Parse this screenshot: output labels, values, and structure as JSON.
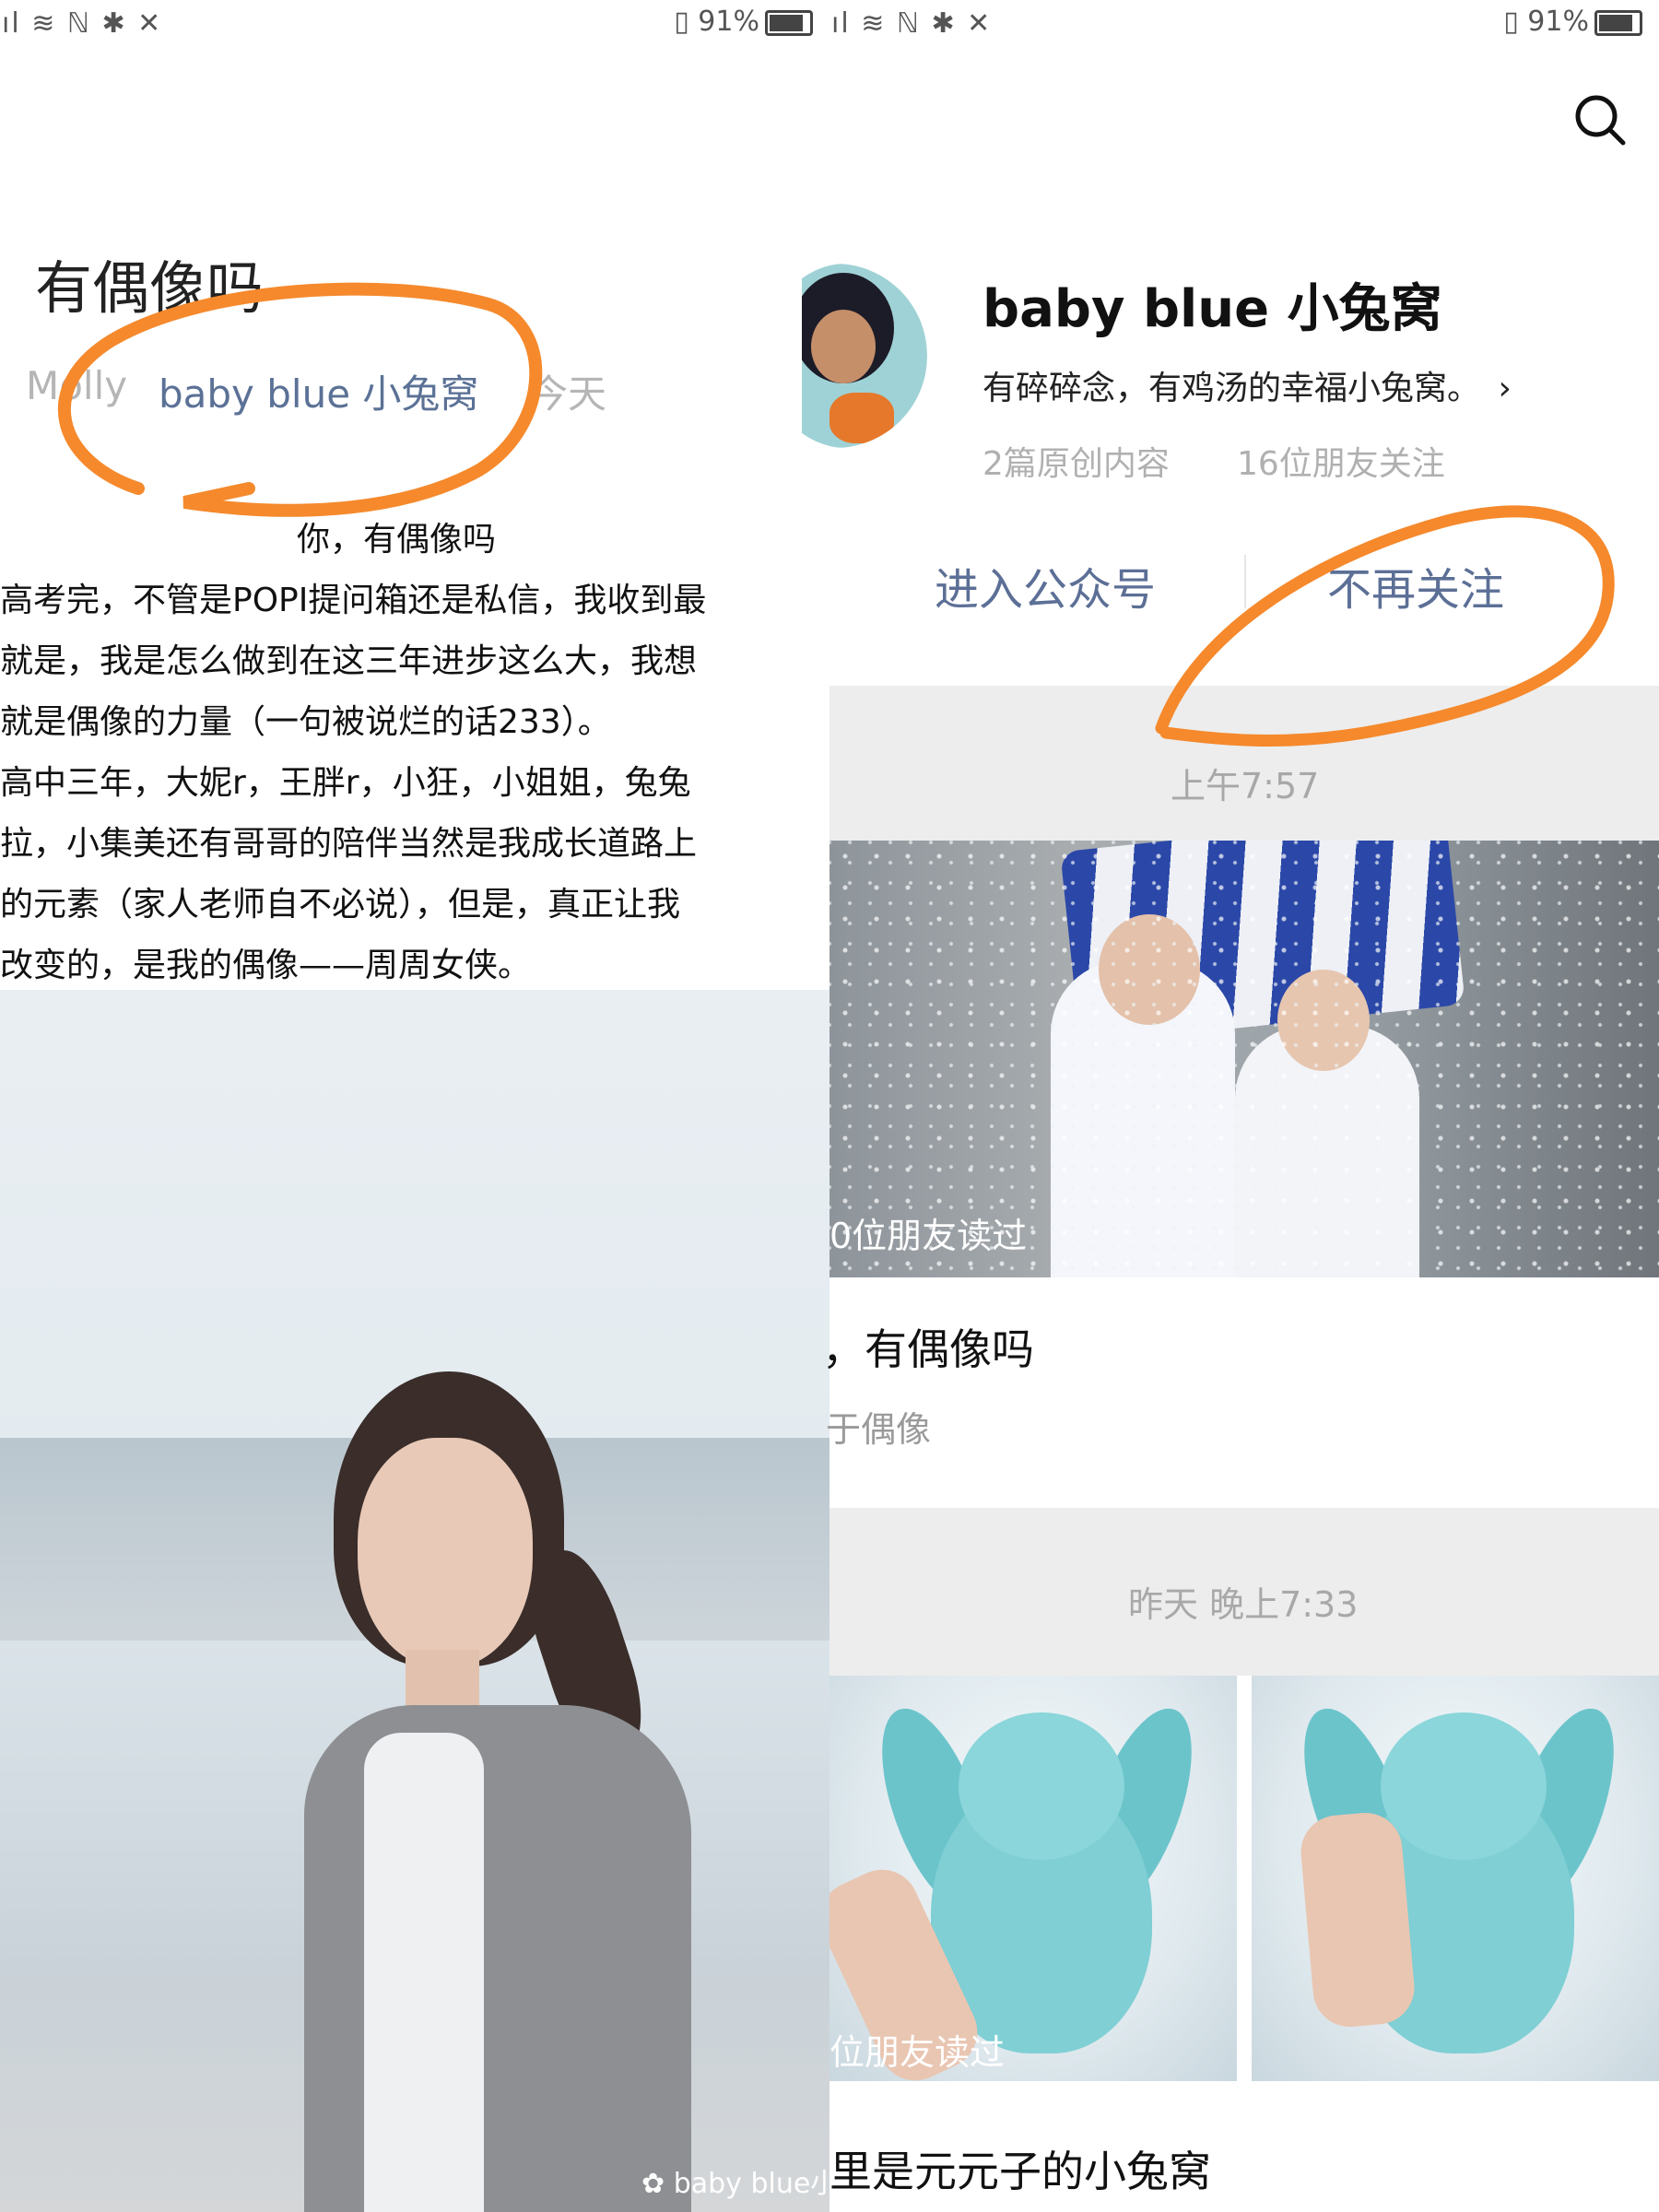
{
  "left": {
    "status_left": "ıl ≋ ℕ ✱ ✕",
    "status_right": "▯ 91%",
    "article_title": "有偶像吗",
    "author": "Molly",
    "account_link": "baby blue 小兔窝",
    "date": "今天",
    "paragraphs": [
      "你，有偶像吗",
      "高考完，不管是POPI提问箱还是私信，我收到最",
      "就是，我是怎么做到在这三年进步这么大，我想",
      "就是偶像的力量（一句被说烂的话233）。",
      "高中三年，大妮r，王胖r，小狂，小姐姐，兔兔",
      "拉，小集美还有哥哥的陪伴当然是我成长道路上",
      "的元素（家人老师自不必说），但是，真正让我",
      "改变的，是我的偶像——周周女侠。"
    ],
    "watermark": "baby blue小"
  },
  "right": {
    "status_left": "ıl ≋ ℕ ✱ ✕",
    "status_right": "▯ 91%",
    "search_icon": "search-icon",
    "account_name": "baby blue 小兔窝",
    "account_desc": "有碎碎念，有鸡汤的幸福小兔窝。",
    "desc_chevron": "›",
    "stat_articles": "2篇原创内容",
    "stat_friends": "16位朋友关注",
    "enter_button": "进入公众号",
    "unfollow_button": "不再关注",
    "feed": [
      {
        "time": "上午7:57",
        "read_overlay": "0位朋友读过",
        "title": "，有偶像吗",
        "tag": "于偶像"
      },
      {
        "time": "昨天 晚上7:33",
        "read_overlay": "位朋友读过",
        "title": "里是元元子的小兔窝"
      }
    ]
  },
  "colors": {
    "link_blue": "#5c6f96",
    "annotation_orange": "#f5892c",
    "band_gray": "#ededed",
    "meta_gray": "#b0b0b0"
  }
}
